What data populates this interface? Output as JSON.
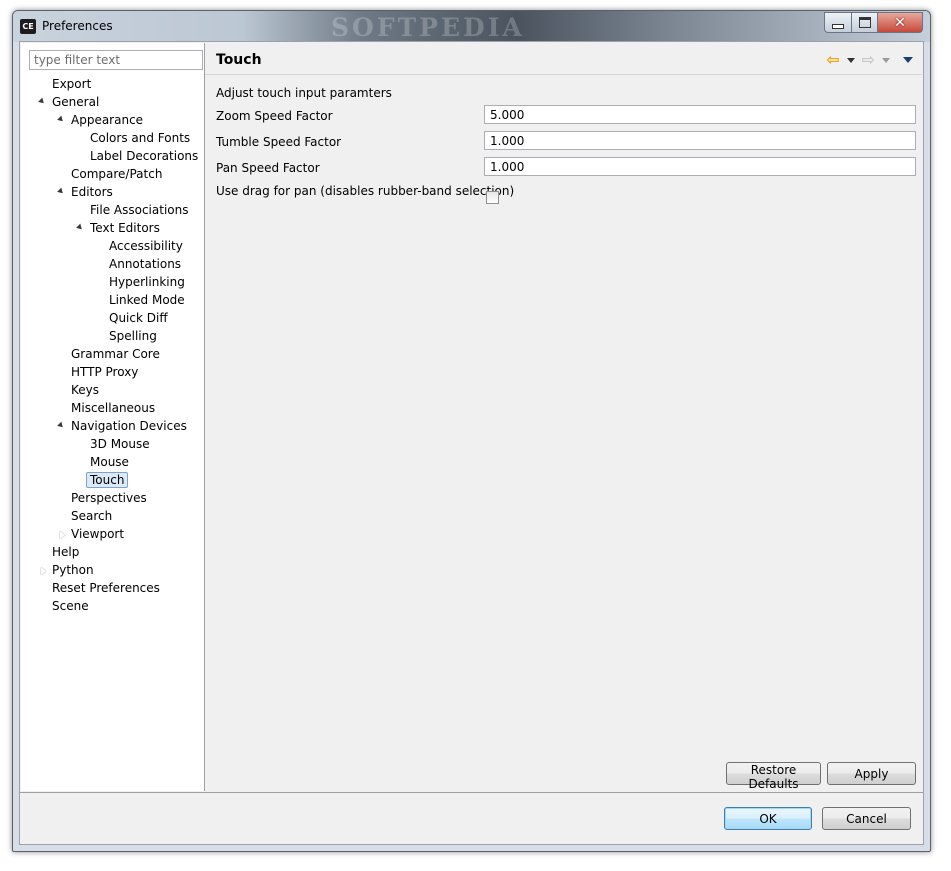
{
  "window": {
    "title": "Preferences",
    "app_icon_text": "CE",
    "watermark": "SOFTPEDIA"
  },
  "filter": {
    "placeholder": "type filter text",
    "value": ""
  },
  "tree": [
    {
      "label": "Export",
      "level": 0,
      "expand": "none"
    },
    {
      "label": "General",
      "level": 0,
      "expand": "open"
    },
    {
      "label": "Appearance",
      "level": 1,
      "expand": "open"
    },
    {
      "label": "Colors and Fonts",
      "level": 2,
      "expand": "none"
    },
    {
      "label": "Label Decorations",
      "level": 2,
      "expand": "none"
    },
    {
      "label": "Compare/Patch",
      "level": 1,
      "expand": "none"
    },
    {
      "label": "Editors",
      "level": 1,
      "expand": "open"
    },
    {
      "label": "File Associations",
      "level": 2,
      "expand": "none"
    },
    {
      "label": "Text Editors",
      "level": 2,
      "expand": "open"
    },
    {
      "label": "Accessibility",
      "level": 3,
      "expand": "none"
    },
    {
      "label": "Annotations",
      "level": 3,
      "expand": "none"
    },
    {
      "label": "Hyperlinking",
      "level": 3,
      "expand": "none"
    },
    {
      "label": "Linked Mode",
      "level": 3,
      "expand": "none"
    },
    {
      "label": "Quick Diff",
      "level": 3,
      "expand": "none"
    },
    {
      "label": "Spelling",
      "level": 3,
      "expand": "none"
    },
    {
      "label": "Grammar Core",
      "level": 1,
      "expand": "none"
    },
    {
      "label": "HTTP Proxy",
      "level": 1,
      "expand": "none"
    },
    {
      "label": "Keys",
      "level": 1,
      "expand": "none"
    },
    {
      "label": "Miscellaneous",
      "level": 1,
      "expand": "none"
    },
    {
      "label": "Navigation Devices",
      "level": 1,
      "expand": "open"
    },
    {
      "label": "3D Mouse",
      "level": 2,
      "expand": "none"
    },
    {
      "label": "Mouse",
      "level": 2,
      "expand": "none"
    },
    {
      "label": "Touch",
      "level": 2,
      "expand": "none",
      "selected": true
    },
    {
      "label": "Perspectives",
      "level": 1,
      "expand": "none"
    },
    {
      "label": "Search",
      "level": 1,
      "expand": "none"
    },
    {
      "label": "Viewport",
      "level": 1,
      "expand": "closed"
    },
    {
      "label": "Help",
      "level": 0,
      "expand": "none"
    },
    {
      "label": "Python",
      "level": 0,
      "expand": "closed"
    },
    {
      "label": "Reset Preferences",
      "level": 0,
      "expand": "none"
    },
    {
      "label": "Scene",
      "level": 0,
      "expand": "none"
    }
  ],
  "page": {
    "title": "Touch",
    "description": "Adjust touch input paramters",
    "fields": [
      {
        "label": "Zoom Speed Factor",
        "value": "5.000"
      },
      {
        "label": "Tumble Speed Factor",
        "value": "1.000"
      },
      {
        "label": "Pan Speed Factor",
        "value": "1.000"
      }
    ],
    "checkbox_label": "Use drag for pan (disables rubber-band selection)",
    "checkbox_checked": false,
    "restore_defaults": "Restore Defaults",
    "apply": "Apply"
  },
  "footer": {
    "ok": "OK",
    "cancel": "Cancel"
  },
  "icons": {
    "back": "back-arrow-icon",
    "forward": "forward-arrow-icon",
    "view_menu": "view-menu-icon"
  }
}
